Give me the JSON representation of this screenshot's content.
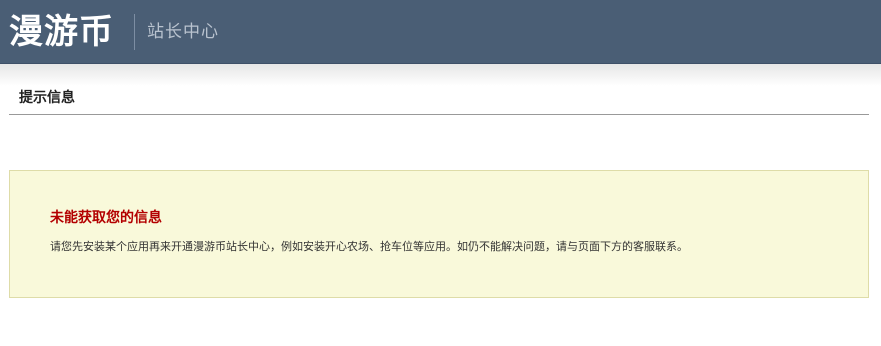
{
  "header": {
    "logo_text": "漫游币",
    "subtitle": "站长中心"
  },
  "section": {
    "title": "提示信息"
  },
  "notice": {
    "title": "未能获取您的信息",
    "message": "请您先安装某个应用再来开通漫游币站长中心，例如安装开心农场、抢车位等应用。如仍不能解决问题，请与页面下方的客服联系。"
  },
  "colors": {
    "header_bg": "#4a5e75",
    "notice_bg": "#f9f9da",
    "notice_title": "#b30000"
  }
}
